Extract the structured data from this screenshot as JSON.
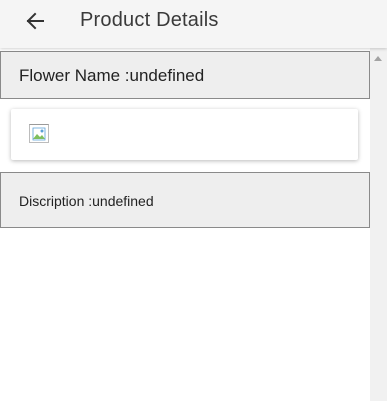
{
  "header": {
    "title": "Product Details",
    "back_icon": "arrow-left-icon"
  },
  "product": {
    "name_text": "Flower Name :undefined",
    "image_icon": "broken-image-icon",
    "description_text": "Discription :undefined"
  },
  "colors": {
    "toolbar_bg": "#f5f5f5",
    "bar_bg": "#eeeeee",
    "bar_border": "#8a8a8a",
    "title_text": "#3a3a3a"
  }
}
